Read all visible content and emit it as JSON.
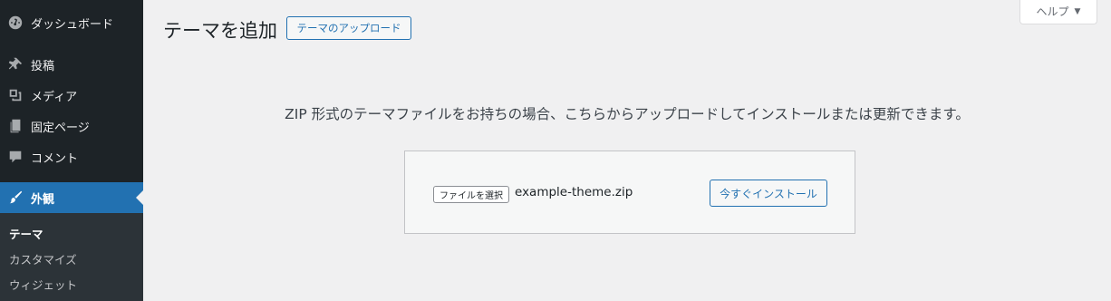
{
  "sidebar": {
    "items": [
      {
        "label": "ダッシュボード",
        "icon": "dashboard-icon"
      },
      {
        "label": "投稿",
        "icon": "pin-icon"
      },
      {
        "label": "メディア",
        "icon": "media-icon"
      },
      {
        "label": "固定ページ",
        "icon": "page-icon"
      },
      {
        "label": "コメント",
        "icon": "comment-icon"
      },
      {
        "label": "外観",
        "icon": "brush-icon",
        "current": true
      }
    ],
    "submenu": [
      {
        "label": "テーマ",
        "current": true
      },
      {
        "label": "カスタマイズ"
      },
      {
        "label": "ウィジェット"
      }
    ]
  },
  "header": {
    "title": "テーマを追加",
    "upload_button": "テーマのアップロード",
    "help_label": "ヘルプ",
    "help_caret": "▼"
  },
  "main": {
    "description": "ZIP 形式のテーマファイルをお持ちの場合、こちらからアップロードしてインストールまたは更新できます。",
    "file_button": "ファイルを選択",
    "file_name": "example-theme.zip",
    "install_button": "今すぐインストール"
  },
  "colors": {
    "accent": "#2271b1",
    "sidebar_bg": "#1d2327",
    "submenu_bg": "#2c3338",
    "page_bg": "#f0f0f1"
  }
}
